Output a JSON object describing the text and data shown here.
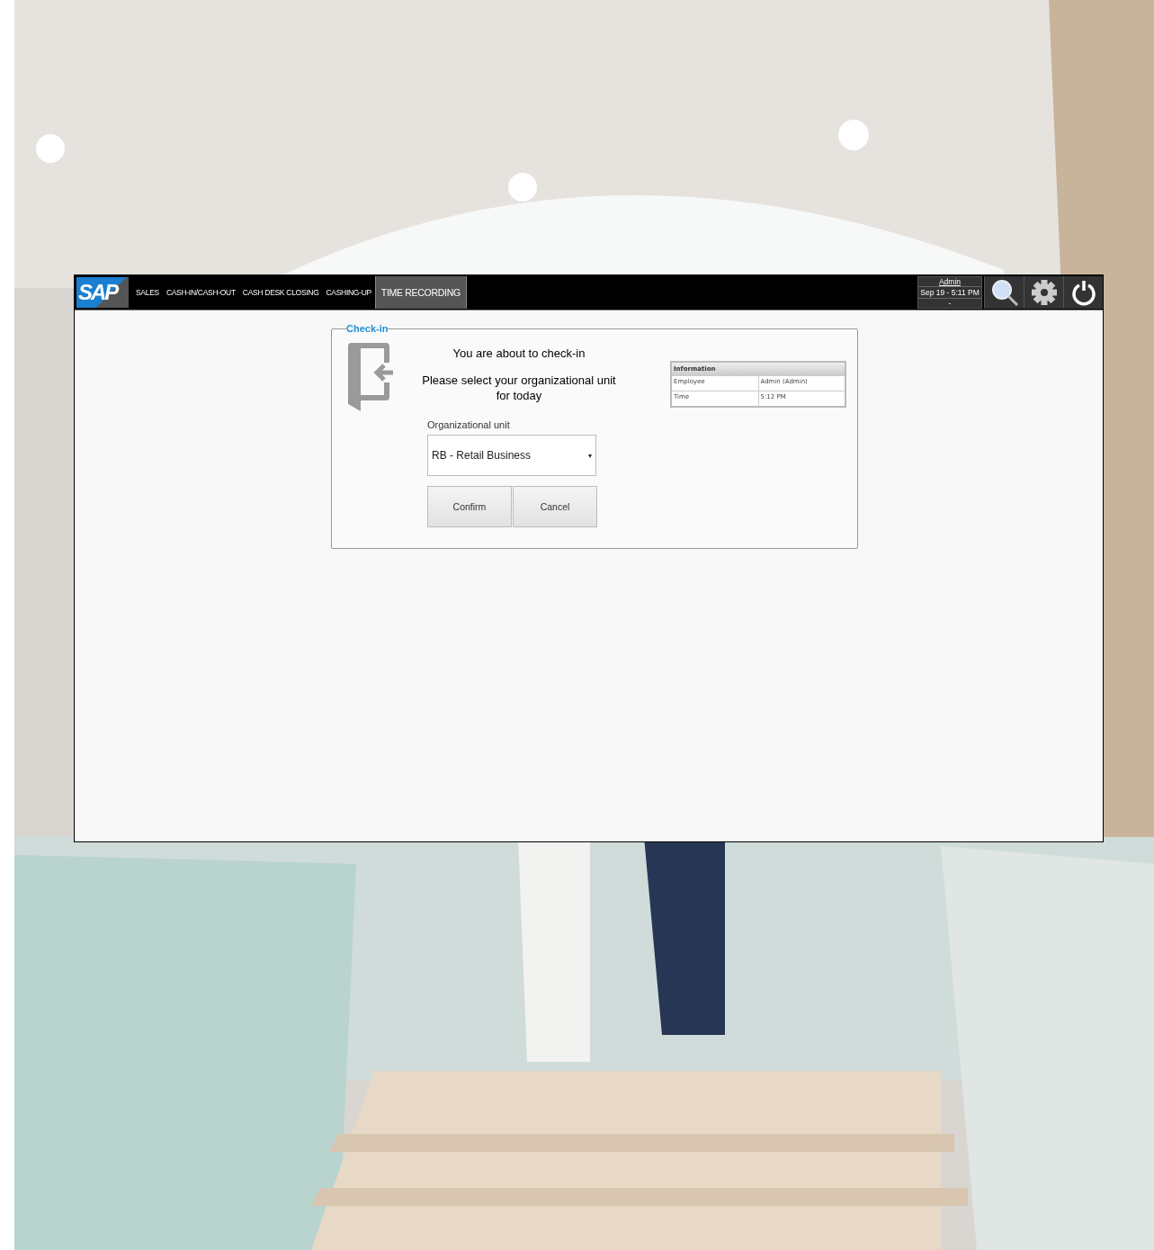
{
  "logo": "SAP",
  "tabs": [
    {
      "label": "SALES",
      "selected": false
    },
    {
      "label": "CASH-IN/CASH-OUT",
      "selected": false
    },
    {
      "label": "CASH DESK CLOSING",
      "selected": false
    },
    {
      "label": "CASHING-UP",
      "selected": false
    },
    {
      "label": "TIME RECORDING",
      "selected": true
    }
  ],
  "user": {
    "name": "Admin",
    "datetime": "Sep 19 - 5:11 PM",
    "extra": "-"
  },
  "panel": {
    "title": "Check-in",
    "heading": "You are about to check-in",
    "prompt": "Please select your organizational unit for today",
    "field": {
      "label": "Organizational unit",
      "value": "RB - Retail Business",
      "caret": "▾"
    },
    "buttons": [
      "Confirm",
      "Cancel"
    ]
  },
  "information": {
    "title": "Information",
    "rows": [
      {
        "label": "Employee",
        "value": "Admin (Admin)"
      },
      {
        "label": "Time",
        "value": "5:12 PM"
      }
    ]
  }
}
